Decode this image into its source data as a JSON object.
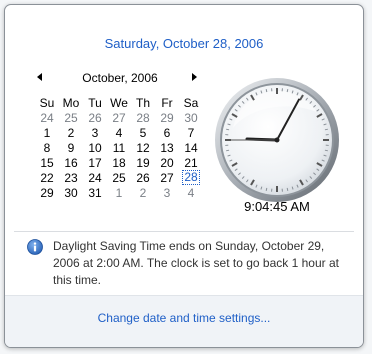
{
  "header": {
    "long_date": "Saturday, October 28, 2006"
  },
  "calendar": {
    "month_title": "October, 2006",
    "weekdays": [
      "Su",
      "Mo",
      "Tu",
      "We",
      "Th",
      "Fr",
      "Sa"
    ],
    "weeks": [
      [
        {
          "d": "24",
          "o": true
        },
        {
          "d": "25",
          "o": true
        },
        {
          "d": "26",
          "o": true
        },
        {
          "d": "27",
          "o": true
        },
        {
          "d": "28",
          "o": true
        },
        {
          "d": "29",
          "o": true
        },
        {
          "d": "30",
          "o": true
        }
      ],
      [
        {
          "d": "1"
        },
        {
          "d": "2"
        },
        {
          "d": "3"
        },
        {
          "d": "4"
        },
        {
          "d": "5"
        },
        {
          "d": "6"
        },
        {
          "d": "7"
        }
      ],
      [
        {
          "d": "8"
        },
        {
          "d": "9"
        },
        {
          "d": "10"
        },
        {
          "d": "11"
        },
        {
          "d": "12"
        },
        {
          "d": "13"
        },
        {
          "d": "14"
        }
      ],
      [
        {
          "d": "15"
        },
        {
          "d": "16"
        },
        {
          "d": "17"
        },
        {
          "d": "18"
        },
        {
          "d": "19"
        },
        {
          "d": "20"
        },
        {
          "d": "21"
        }
      ],
      [
        {
          "d": "22"
        },
        {
          "d": "23"
        },
        {
          "d": "24"
        },
        {
          "d": "25"
        },
        {
          "d": "26"
        },
        {
          "d": "27"
        },
        {
          "d": "28",
          "today": true
        }
      ],
      [
        {
          "d": "29"
        },
        {
          "d": "30"
        },
        {
          "d": "31"
        },
        {
          "d": "1",
          "o": true
        },
        {
          "d": "2",
          "o": true
        },
        {
          "d": "3",
          "o": true
        },
        {
          "d": "4",
          "o": true
        }
      ]
    ],
    "prev_icon": "triangle-left-icon",
    "next_icon": "triangle-right-icon"
  },
  "clock": {
    "time_text": "9:04:45 AM",
    "hours": 9,
    "minutes": 4,
    "seconds": 45
  },
  "notice": {
    "icon": "info-icon",
    "text": "Daylight Saving Time ends on Sunday, October 29, 2006 at 2:00 AM. The clock is set to go back 1 hour at this time."
  },
  "footer": {
    "settings_link": "Change date and time settings..."
  },
  "colors": {
    "link": "#1f5fc7",
    "info_icon": "#3a74c9"
  }
}
